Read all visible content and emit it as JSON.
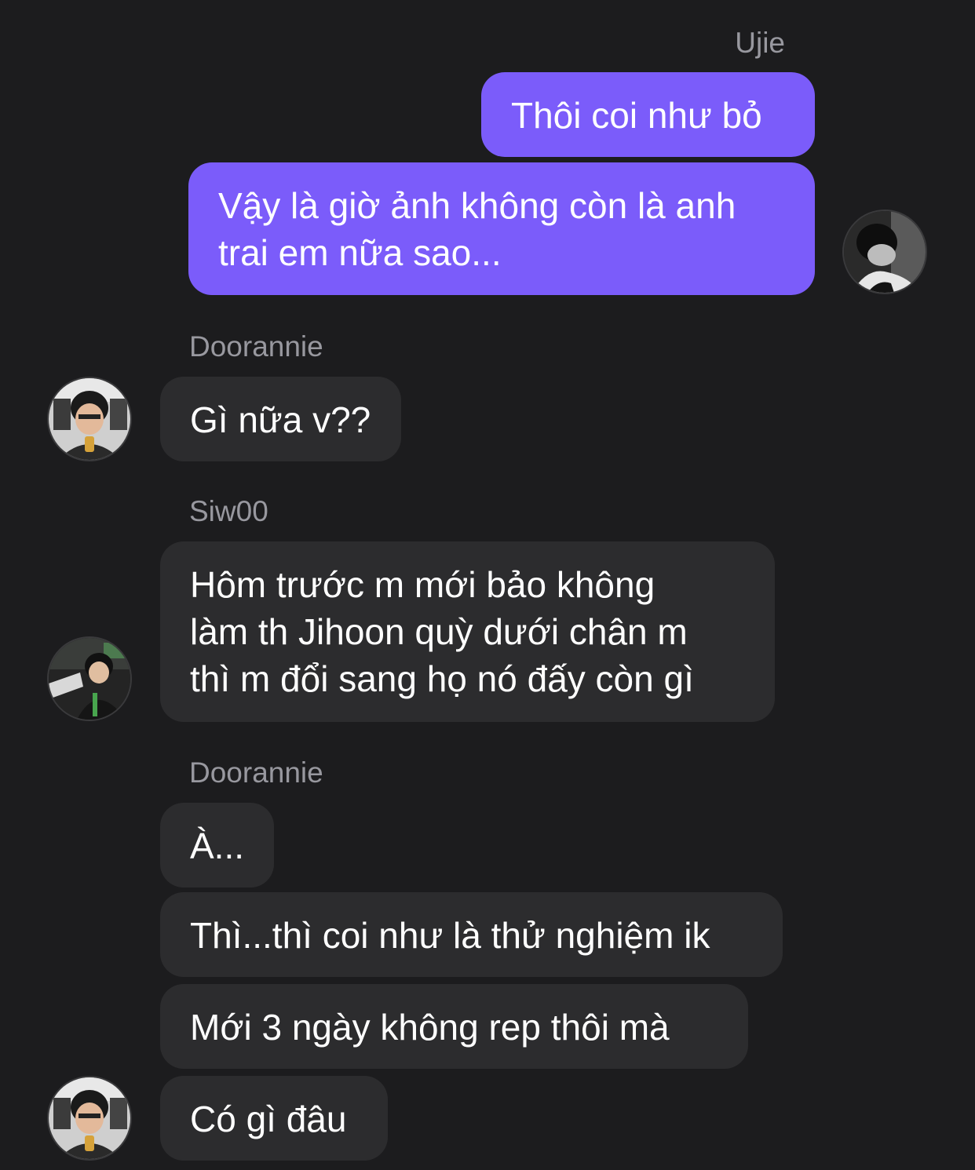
{
  "thread": {
    "groups": [
      {
        "sender": "Ujie",
        "direction": "outgoing",
        "messages": [
          {
            "lines": [
              "Thôi coi như bỏ"
            ]
          },
          {
            "lines": [
              "Vậy là giờ ảnh không còn là anh",
              "trai em nữa sao..."
            ]
          }
        ],
        "avatar_icon": "avatar-ujie-photo"
      },
      {
        "sender": "Doorannie",
        "direction": "incoming",
        "messages": [
          {
            "lines": [
              "Gì nữa v??"
            ]
          }
        ],
        "avatar_icon": "avatar-doorannie-photo"
      },
      {
        "sender": "Siw00",
        "direction": "incoming",
        "messages": [
          {
            "lines": [
              "Hôm trước m mới bảo không",
              "làm th Jihoon quỳ dưới chân m",
              "thì m đổi sang họ nó đấy còn gì"
            ]
          }
        ],
        "avatar_icon": "avatar-siw00-photo"
      },
      {
        "sender": "Doorannie",
        "direction": "incoming",
        "messages": [
          {
            "lines": [
              "À..."
            ]
          },
          {
            "lines": [
              "Thì...thì coi như là thử nghiệm ik"
            ]
          },
          {
            "lines": [
              "Mới 3 ngày không rep thôi mà"
            ]
          },
          {
            "lines": [
              "Có gì đâu"
            ]
          }
        ],
        "avatar_icon": "avatar-doorannie-photo"
      }
    ]
  },
  "colors": {
    "background": "#1c1c1e",
    "outgoing_bubble": "#7b5cfa",
    "incoming_bubble": "#2c2c2e",
    "sender_name": "#98989f",
    "text": "#ffffff"
  }
}
